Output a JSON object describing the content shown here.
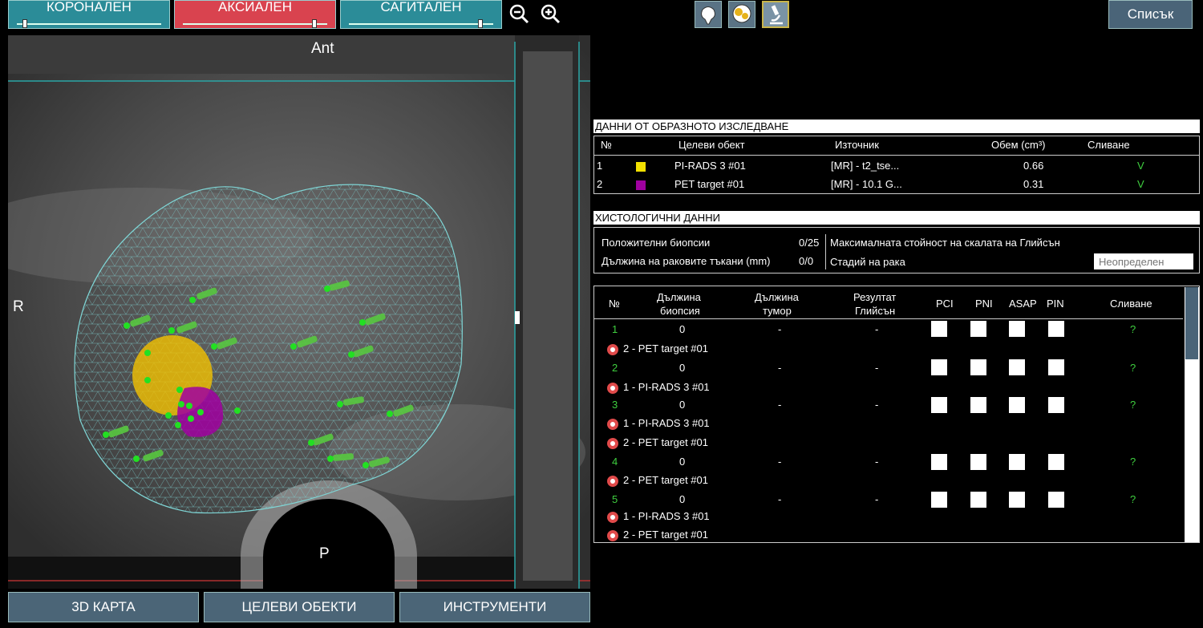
{
  "views": {
    "coronal": "КОРОНАЛЕН",
    "axial": "АКСИАЛЕН",
    "sagittal": "САГИТАЛЕН"
  },
  "colors": {
    "coronal": "#2b8c98",
    "axial": "#d9434f",
    "sagittal": "#2b8c98",
    "target1": "#f2e000",
    "target2": "#a000a0"
  },
  "list_button": "Списък",
  "viewer": {
    "ant": "Ant",
    "post": "P",
    "right": "R"
  },
  "imaging": {
    "title": "ДАННИ ОТ ОБРАЗНОТО ИЗСЛЕДВАНЕ",
    "headers": {
      "num": "№",
      "target": "Целеви обект",
      "source": "Източник",
      "volume": "Обем (cm³)",
      "fusion": "Сливане"
    },
    "rows": [
      {
        "num": "1",
        "target": "PI-RADS 3 #01",
        "source": "[MR] - t2_tse...",
        "volume": "0.66",
        "fusion": "V"
      },
      {
        "num": "2",
        "target": "PET target #01",
        "source": "[MR] - 10.1 G...",
        "volume": "0.31",
        "fusion": "V"
      }
    ]
  },
  "histology": {
    "title": "ХИСТОЛОГИЧНИ ДАННИ",
    "positive_label": "Положителни биопсии",
    "positive_value": "0/25",
    "length_label": "Дължина на раковите тъкани (mm)",
    "length_value": "0/0",
    "gleason_label": "Максималната стойност на скалата на Глийсън",
    "stage_label": "Стадий на рака",
    "stage_placeholder": "Неопределен"
  },
  "biopsy": {
    "headers": {
      "num": "№",
      "len1": "Дължина",
      "len2": "биопсия",
      "tum1": "Дължина",
      "tum2": "тумор",
      "res1": "Резултат",
      "res2": "Глийсън",
      "pci": "PCI",
      "pni": "PNI",
      "asap": "ASAP",
      "pin": "PIN",
      "fusion": "Сливане"
    },
    "rows": [
      {
        "num": "1",
        "length": "0",
        "tumor": "-",
        "gleason": "-",
        "fusion": "?",
        "targets": [
          "2 - PET target #01"
        ]
      },
      {
        "num": "2",
        "length": "0",
        "tumor": "-",
        "gleason": "-",
        "fusion": "?",
        "targets": [
          "1 - PI-RADS 3 #01"
        ]
      },
      {
        "num": "3",
        "length": "0",
        "tumor": "-",
        "gleason": "-",
        "fusion": "?",
        "targets": [
          "1 - PI-RADS 3 #01",
          "2 - PET target #01"
        ]
      },
      {
        "num": "4",
        "length": "0",
        "tumor": "-",
        "gleason": "-",
        "fusion": "?",
        "targets": [
          "2 - PET target #01"
        ]
      },
      {
        "num": "5",
        "length": "0",
        "tumor": "-",
        "gleason": "-",
        "fusion": "?",
        "targets": [
          "1 - PI-RADS 3 #01",
          "2 - PET target #01"
        ]
      }
    ]
  },
  "bottom": {
    "map": "3D КАРТА",
    "targets": "ЦЕЛЕВИ ОБЕКТИ",
    "tools": "ИНСТРУМЕНТИ"
  }
}
